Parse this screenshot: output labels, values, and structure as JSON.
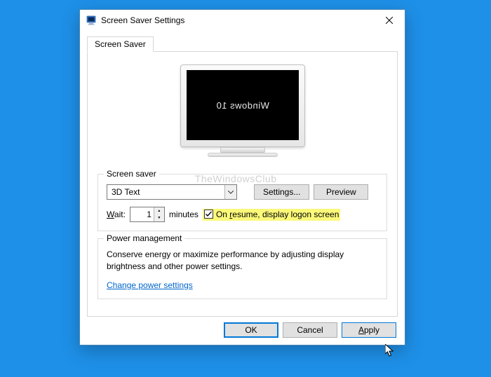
{
  "window": {
    "title": "Screen Saver Settings",
    "tab_label": "Screen Saver"
  },
  "preview": {
    "screensaver_text": "Windows 10"
  },
  "watermark": "TheWindowsClub",
  "screensaver_group": {
    "label": "Screen saver",
    "dropdown_value": "3D Text",
    "settings_btn": "Settings...",
    "preview_btn": "Preview",
    "wait_label": "Wait:",
    "wait_value": "1",
    "minutes_label": "minutes",
    "resume_checked": true,
    "resume_label": "On resume, display logon screen"
  },
  "power_group": {
    "label": "Power management",
    "desc": "Conserve energy or maximize performance by adjusting display brightness and other power settings.",
    "link": "Change power settings"
  },
  "buttons": {
    "ok": "OK",
    "cancel": "Cancel",
    "apply": "Apply"
  }
}
